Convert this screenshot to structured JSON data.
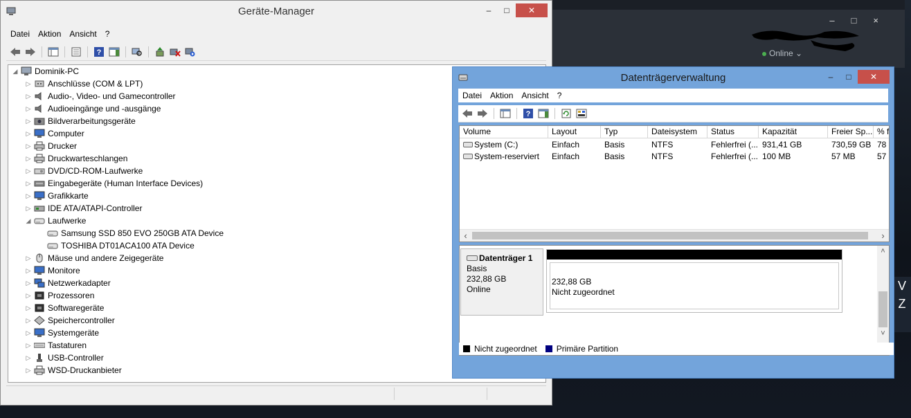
{
  "background_app": {
    "status_text": "Online"
  },
  "device_manager": {
    "title": "Geräte-Manager",
    "menu": [
      "Datei",
      "Aktion",
      "Ansicht",
      "?"
    ],
    "tree": [
      {
        "label": "Dominik-PC",
        "level": 0,
        "expander": "expanded",
        "icon": "computer-icon"
      },
      {
        "label": "Anschlüsse (COM & LPT)",
        "level": 1,
        "expander": "collapsed",
        "icon": "port-icon"
      },
      {
        "label": "Audio-, Video- und Gamecontroller",
        "level": 1,
        "expander": "collapsed",
        "icon": "speaker-icon"
      },
      {
        "label": "Audioeingänge und -ausgänge",
        "level": 1,
        "expander": "collapsed",
        "icon": "speaker-icon"
      },
      {
        "label": "Bildverarbeitungsgeräte",
        "level": 1,
        "expander": "collapsed",
        "icon": "camera-icon"
      },
      {
        "label": "Computer",
        "level": 1,
        "expander": "collapsed",
        "icon": "monitor-icon"
      },
      {
        "label": "Drucker",
        "level": 1,
        "expander": "collapsed",
        "icon": "printer-icon"
      },
      {
        "label": "Druckwarteschlangen",
        "level": 1,
        "expander": "collapsed",
        "icon": "printer-icon"
      },
      {
        "label": "DVD/CD-ROM-Laufwerke",
        "level": 1,
        "expander": "collapsed",
        "icon": "disc-drive-icon"
      },
      {
        "label": "Eingabegeräte (Human Interface Devices)",
        "level": 1,
        "expander": "collapsed",
        "icon": "hid-icon"
      },
      {
        "label": "Grafikkarte",
        "level": 1,
        "expander": "collapsed",
        "icon": "monitor-icon"
      },
      {
        "label": "IDE ATA/ATAPI-Controller",
        "level": 1,
        "expander": "collapsed",
        "icon": "controller-icon"
      },
      {
        "label": "Laufwerke",
        "level": 1,
        "expander": "expanded",
        "icon": "drive-icon"
      },
      {
        "label": "Samsung SSD 850 EVO 250GB ATA Device",
        "level": 2,
        "expander": "none",
        "icon": "drive-icon"
      },
      {
        "label": "TOSHIBA DT01ACA100 ATA Device",
        "level": 2,
        "expander": "none",
        "icon": "drive-icon"
      },
      {
        "label": "Mäuse und andere Zeigegeräte",
        "level": 1,
        "expander": "collapsed",
        "icon": "mouse-icon"
      },
      {
        "label": "Monitore",
        "level": 1,
        "expander": "collapsed",
        "icon": "monitor-icon"
      },
      {
        "label": "Netzwerkadapter",
        "level": 1,
        "expander": "collapsed",
        "icon": "network-icon"
      },
      {
        "label": "Prozessoren",
        "level": 1,
        "expander": "collapsed",
        "icon": "chip-icon"
      },
      {
        "label": "Softwaregeräte",
        "level": 1,
        "expander": "collapsed",
        "icon": "chip-icon"
      },
      {
        "label": "Speichercontroller",
        "level": 1,
        "expander": "collapsed",
        "icon": "storage-controller-icon"
      },
      {
        "label": "Systemgeräte",
        "level": 1,
        "expander": "collapsed",
        "icon": "monitor-icon"
      },
      {
        "label": "Tastaturen",
        "level": 1,
        "expander": "collapsed",
        "icon": "keyboard-icon"
      },
      {
        "label": "USB-Controller",
        "level": 1,
        "expander": "collapsed",
        "icon": "usb-icon"
      },
      {
        "label": "WSD-Druckanbieter",
        "level": 1,
        "expander": "collapsed",
        "icon": "printer-icon"
      }
    ]
  },
  "disk_management": {
    "title": "Datenträgerverwaltung",
    "menu": [
      "Datei",
      "Aktion",
      "Ansicht",
      "?"
    ],
    "columns": [
      "Volume",
      "Layout",
      "Typ",
      "Dateisystem",
      "Status",
      "Kapazität",
      "Freier Sp...",
      "% f"
    ],
    "rows": [
      [
        "System (C:)",
        "Einfach",
        "Basis",
        "NTFS",
        "Fehlerfrei (...",
        "931,41 GB",
        "730,59 GB",
        "78"
      ],
      [
        "System-reserviert",
        "Einfach",
        "Basis",
        "NTFS",
        "Fehlerfrei (...",
        "100 MB",
        "57 MB",
        "57"
      ]
    ],
    "disk": {
      "name": "Datenträger 1",
      "type": "Basis",
      "size": "232,88 GB",
      "status": "Online",
      "partition_size": "232,88 GB",
      "partition_status": "Nicht zugeordnet"
    },
    "legend": [
      {
        "label": "Nicht zugeordnet",
        "color": "#000000"
      },
      {
        "label": "Primäre Partition",
        "color": "#00007f"
      }
    ]
  }
}
